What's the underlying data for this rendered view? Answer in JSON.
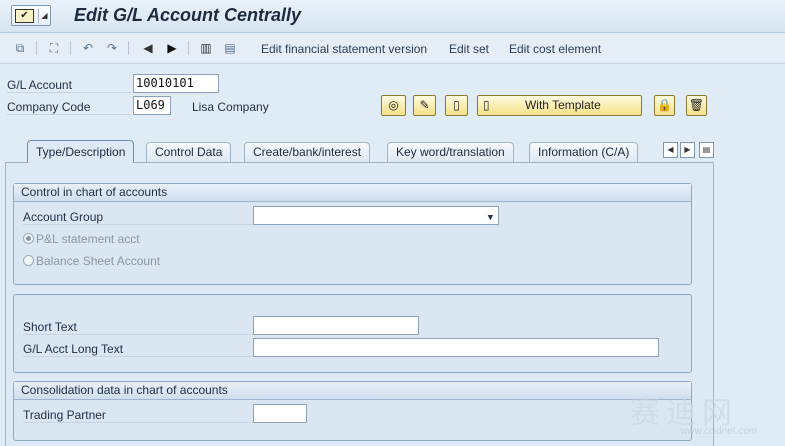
{
  "window": {
    "title": "Edit G/L Account Centrally"
  },
  "toolbar": {
    "items": [
      "Edit financial statement version",
      "Edit set",
      "Edit cost element"
    ]
  },
  "header": {
    "gl_account_label": "G/L Account",
    "gl_account_value": "10010101",
    "company_code_label": "Company Code",
    "company_code_value": "L069",
    "company_name": "Lisa Company",
    "with_template_label": "With Template"
  },
  "tabs": [
    "Type/Description",
    "Control Data",
    "Create/bank/interest",
    "Key word/translation",
    "Information (C/A)"
  ],
  "control_group": {
    "title": "Control in chart of accounts",
    "account_group_label": "Account Group",
    "account_group_value": "",
    "radio_pl": "P&L statement acct",
    "radio_bs": "Balance Sheet Account",
    "selected": "P&L statement acct"
  },
  "description_group": {
    "short_text_label": "Short Text",
    "short_text_value": "",
    "long_text_label": "G/L Acct Long Text",
    "long_text_value": ""
  },
  "consolidation_group": {
    "title": "Consolidation data in chart of accounts",
    "trading_partner_label": "Trading Partner",
    "trading_partner_value": ""
  },
  "watermark": {
    "text": "赛迪网",
    "url": "www.ccidnet.com"
  }
}
